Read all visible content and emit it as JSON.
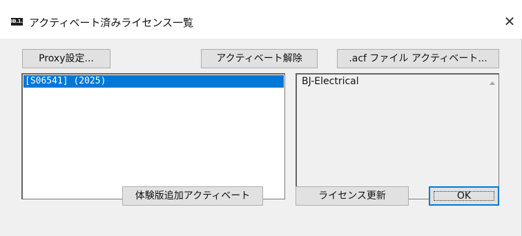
{
  "window": {
    "icon_label": "IB.1.1",
    "title": "アクティベート済みライセンス一覧",
    "close_glyph": "✕"
  },
  "toolbar": {
    "proxy_label": "Proxy設定...",
    "deactivate_label": "アクティベート解除",
    "acf_label": ".acf ファイル アクティベート..."
  },
  "license_list": {
    "items": [
      {
        "label": "[S06541] (2025)",
        "selected": true
      }
    ]
  },
  "detail": {
    "text": "BJ-Electrical"
  },
  "footer": {
    "trial_label": "体験版追加アクティベート",
    "update_label": "ライセンス更新",
    "ok_label": "OK"
  },
  "colors": {
    "selection": "#0078d7",
    "window_bg": "#f0f0f0",
    "button_bg": "#e1e1e1",
    "default_button_border": "#0078d7"
  }
}
